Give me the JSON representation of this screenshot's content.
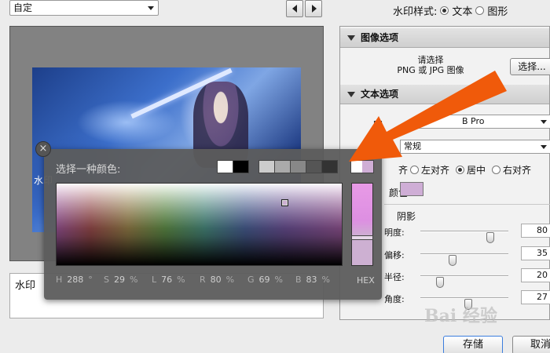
{
  "top": {
    "preset_value": "自定",
    "watermark_style_label": "水印样式:",
    "style_text": "文本",
    "style_graphic": "图形"
  },
  "preview": {
    "watermark_text": "水印"
  },
  "text_input": {
    "value": "水印"
  },
  "image_options": {
    "title": "图像选项",
    "choose_line1": "请选择",
    "choose_line2": "PNG 或 JPG 图像",
    "choose_button": "选择..."
  },
  "text_options": {
    "title": "文本选项",
    "font_label": "字",
    "font_value": "B Pro",
    "weight_value": "常规",
    "align_left": "左对齐",
    "align_center": "居中",
    "align_right": "右对齐",
    "align_label": "齐",
    "color_label": "颜色",
    "color_hex": "#cfaed6",
    "shadow_label": "阴影",
    "sliders": [
      {
        "label": "明度:",
        "value": "80",
        "fraction": 0.82
      },
      {
        "label": "偏移:",
        "value": "35",
        "fraction": 0.35
      },
      {
        "label": "半径:",
        "value": "20",
        "fraction": 0.2
      },
      {
        "label": "角度:",
        "value": "27",
        "fraction": 0.55
      }
    ]
  },
  "buttons": {
    "save": "存储",
    "cancel": "取消"
  },
  "color_picker": {
    "title": "选择一种颜色:",
    "close_icon": "×",
    "bw_swatches": [
      "#ffffff",
      "#000000"
    ],
    "gray_swatches": [
      "#cccccc",
      "#aaaaaa",
      "#888888",
      "#555555",
      "#333333"
    ],
    "current": [
      "#ffffff",
      "#cfaed6"
    ],
    "H": {
      "label": "H",
      "value": "288",
      "unit": "°"
    },
    "S": {
      "label": "S",
      "value": "29",
      "unit": "%"
    },
    "L": {
      "label": "L",
      "value": "76",
      "unit": "%"
    },
    "R": {
      "label": "R",
      "value": "80",
      "unit": "%"
    },
    "G": {
      "label": "G",
      "value": "69",
      "unit": "%"
    },
    "B": {
      "label": "B",
      "value": "83",
      "unit": "%"
    },
    "hex_label": "HEX"
  },
  "site_watermark": "Bai 经验",
  "colors": {
    "accent_arrow": "#f05a0a",
    "selected_color": "#cfaed6"
  }
}
